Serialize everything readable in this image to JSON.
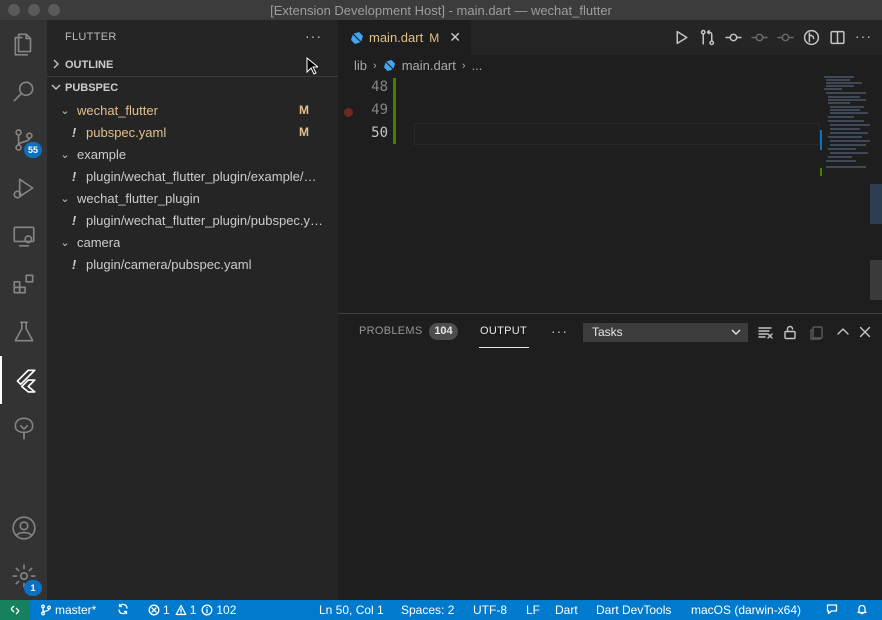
{
  "window": {
    "title": "[Extension Development Host] - main.dart — wechat_flutter"
  },
  "activity_bar": {
    "items": [
      "explorer",
      "search",
      "source-control",
      "run-debug",
      "remote-explorer",
      "extensions",
      "testing",
      "flutter",
      "tree-view"
    ],
    "scm_badge": "55",
    "settings_badge": "1"
  },
  "sidebar": {
    "title": "FLUTTER",
    "more": "···",
    "outline_label": "OUTLINE",
    "pubspec_label": "PUBSPEC",
    "tree": [
      {
        "label": "wechat_flutter",
        "badge": "M"
      },
      {
        "label": "pubspec.yaml",
        "badge": "M"
      },
      {
        "label": "example"
      },
      {
        "label": "plugin/wechat_flutter_plugin/example/pubspec.yaml"
      },
      {
        "label": "wechat_flutter_plugin"
      },
      {
        "label": "plugin/wechat_flutter_plugin/pubspec.yaml"
      },
      {
        "label": "camera"
      },
      {
        "label": "plugin/camera/pubspec.yaml"
      }
    ]
  },
  "editor": {
    "tab": {
      "label": "main.dart",
      "status": "M",
      "close": "✕"
    },
    "more": "···",
    "breadcrumb": {
      "folder": "lib",
      "file": "main.dart",
      "tail": "..."
    },
    "line_numbers": [
      "48",
      "49",
      "50"
    ]
  },
  "panel": {
    "tabs": {
      "problems": "PROBLEMS",
      "output": "OUTPUT"
    },
    "problems_count": "104",
    "more": "···",
    "output_channel": "Tasks"
  },
  "status_bar": {
    "branch": "master*",
    "errors": "1",
    "warnings": "1",
    "infos": "102",
    "cursor": "Ln 50, Col 1",
    "spaces": "Spaces: 2",
    "encoding": "UTF-8",
    "eol": "LF",
    "language": "Dart",
    "devtools": "Dart DevTools",
    "device": "macOS (darwin-x64)"
  },
  "colors": {
    "accent": "#007acc",
    "modified": "#e2c08d",
    "git_added": "#487e02",
    "remote": "#16825d"
  }
}
